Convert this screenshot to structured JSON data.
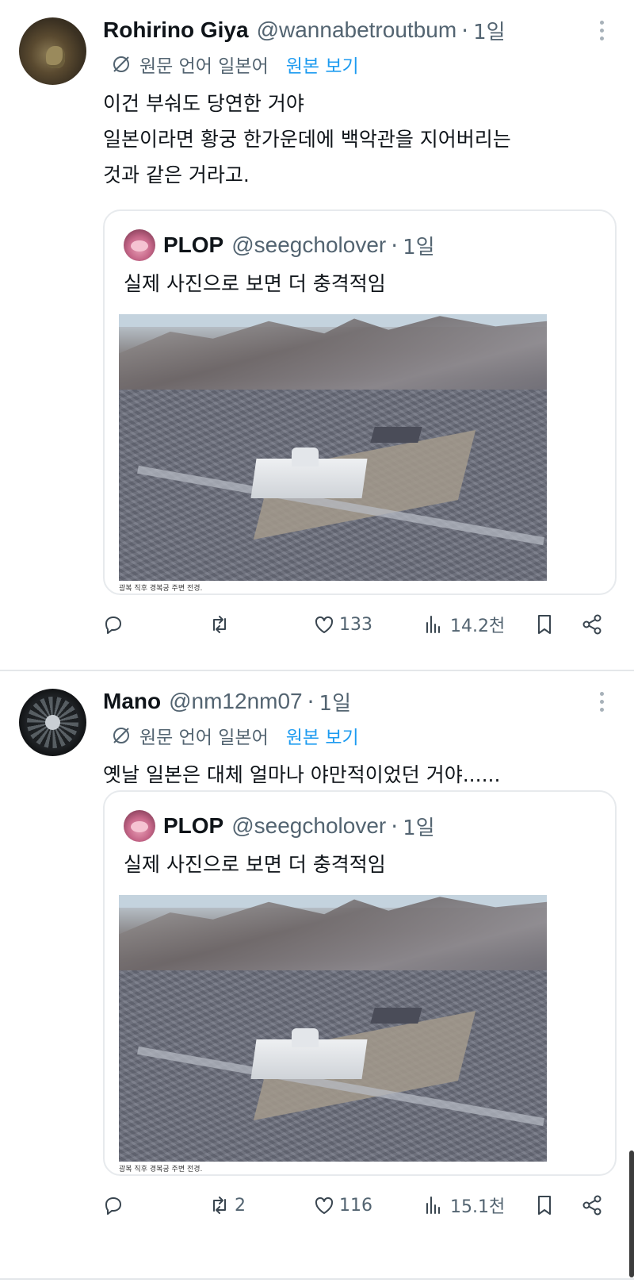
{
  "tweets": [
    {
      "author": {
        "name": "Rohirino Giya",
        "handle": "@wannabetroutbum",
        "time": "1일"
      },
      "translation": {
        "label": "원문 언어 일본어",
        "show_original": "원본 보기"
      },
      "lines": [
        "이건 부숴도 당연한 거야",
        "일본이라면 황궁 한가운데에 백악관을 지어버리는",
        "것과 같은 거라고."
      ],
      "quote": {
        "name": "PLOP",
        "handle": "@seegcholover",
        "time": "1일",
        "text": "실제 사진으로 보면 더 충격적임",
        "caption": "광복 직후 경복궁 주변 전경."
      },
      "actions": {
        "reply": "",
        "retweet": "",
        "like": "133",
        "views": "14.2천"
      }
    },
    {
      "author": {
        "name": "Mano",
        "handle": "@nm12nm07",
        "time": "1일"
      },
      "translation": {
        "label": "원문 언어 일본어",
        "show_original": "원본 보기"
      },
      "lines": [
        "옛날 일본은 대체 얼마나 야만적이었던 거야......"
      ],
      "quote": {
        "name": "PLOP",
        "handle": "@seegcholover",
        "time": "1일",
        "text": "실제 사진으로 보면 더 충격적임",
        "caption": "광복 직후 경복궁 주변 전경."
      },
      "actions": {
        "reply": "",
        "retweet": "2",
        "like": "116",
        "views": "15.1천"
      }
    }
  ],
  "separator": "·",
  "icons": [
    "more-dots-icon",
    "globe-translate-icon",
    "reply-icon",
    "retweet-icon",
    "like-icon",
    "views-icon",
    "bookmark-icon",
    "share-icon"
  ],
  "colors": {
    "link": "#1d9bf0",
    "muted": "#536471",
    "text": "#0f1419"
  }
}
